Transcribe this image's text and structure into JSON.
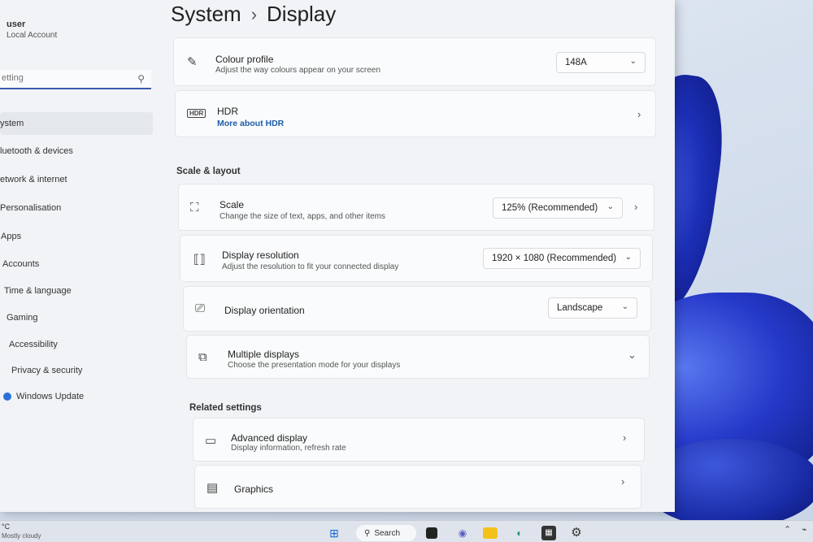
{
  "colors": {
    "accent": "#3b5db0",
    "link": "#1f5ca8",
    "window_bg": "#f1f3f6",
    "card_bg": "#fafbfc"
  },
  "user": {
    "name": "user",
    "account_type": "Local Account"
  },
  "search": {
    "placeholder": "etting"
  },
  "sidebar": {
    "items": [
      {
        "label": "ystem",
        "icon": "system-icon"
      },
      {
        "label": "luetooth & devices",
        "icon": "bluetooth-icon"
      },
      {
        "label": "etwork & internet",
        "icon": "network-icon"
      },
      {
        "label": "Personalisation",
        "icon": "brush-icon"
      },
      {
        "label": "Apps",
        "icon": "apps-icon"
      },
      {
        "label": "Accounts",
        "icon": "accounts-icon"
      },
      {
        "label": "Time & language",
        "icon": "clock-icon"
      },
      {
        "label": "Gaming",
        "icon": "gaming-icon"
      },
      {
        "label": "Accessibility",
        "icon": "accessibility-icon"
      },
      {
        "label": "Privacy & security",
        "icon": "shield-icon"
      },
      {
        "label": "Windows Update",
        "icon": "update-icon"
      }
    ]
  },
  "breadcrumb": {
    "parent": "System",
    "separator": "›",
    "current": "Display"
  },
  "colour_profile": {
    "title": "Colour profile",
    "subtitle": "Adjust the way colours appear on your screen",
    "value": "148A",
    "icon": "pen-icon"
  },
  "hdr": {
    "title": "HDR",
    "link": "More about HDR",
    "icon": "hdr-icon"
  },
  "scale_layout": {
    "heading": "Scale & layout",
    "scale": {
      "title": "Scale",
      "subtitle": "Change the size of text, apps, and other items",
      "value": "125% (Recommended)",
      "icon": "scale-icon"
    },
    "resolution": {
      "title": "Display resolution",
      "subtitle": "Adjust the resolution to fit your connected display",
      "value": "1920 × 1080 (Recommended)",
      "icon": "resolution-icon"
    },
    "orientation": {
      "title": "Display orientation",
      "value": "Landscape",
      "icon": "orientation-icon"
    },
    "multiple": {
      "title": "Multiple displays",
      "subtitle": "Choose the presentation mode for your displays",
      "icon": "multiple-displays-icon"
    }
  },
  "related": {
    "heading": "Related settings",
    "advanced": {
      "title": "Advanced display",
      "subtitle": "Display information, refresh rate",
      "icon": "monitor-icon"
    },
    "graphics": {
      "title": "Graphics",
      "icon": "graphics-icon"
    }
  },
  "taskbar": {
    "weather_temp": "°C",
    "weather_desc": "Mostly cloudy",
    "search_label": "Search",
    "icons": [
      "windows-start-icon",
      "search-icon",
      "task-view-icon",
      "teams-chat-icon",
      "file-explorer-icon",
      "edge-icon",
      "store-icon",
      "settings-icon"
    ]
  }
}
